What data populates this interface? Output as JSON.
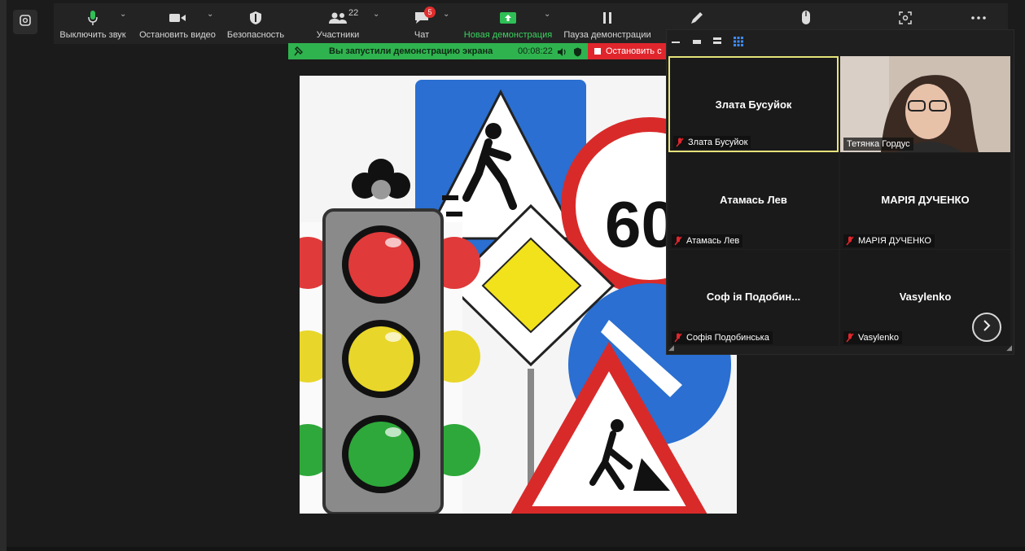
{
  "toolbar": {
    "items": [
      {
        "label": "Выключить звук",
        "icon": "microphone-icon"
      },
      {
        "label": "Остановить видео",
        "icon": "video-camera-icon"
      },
      {
        "label": "Безопасность",
        "icon": "shield-icon"
      },
      {
        "label": "Участники",
        "icon": "participants-icon",
        "count": "22"
      },
      {
        "label": "Чат",
        "icon": "chat-icon",
        "badge": "5"
      },
      {
        "label": "Новая демонстрация",
        "icon": "share-screen-icon"
      },
      {
        "label": "Пауза демонстрации",
        "icon": "pause-icon"
      },
      {
        "label": "",
        "icon": "annotate-pen-icon"
      },
      {
        "label": "",
        "icon": "remote-control-mouse-icon"
      },
      {
        "label": "",
        "icon": "record-icon"
      },
      {
        "label": "",
        "icon": "more-dots-icon"
      }
    ]
  },
  "sharing": {
    "message": "Вы запустили демонстрацию экрана",
    "timer": "00:08:22",
    "stop_label": "Остановить с"
  },
  "gallery": {
    "tiles": [
      {
        "display": "Злата Бусуйок",
        "tag": "Злата Бусуйок",
        "muted": true,
        "active": true,
        "video": false
      },
      {
        "display": "",
        "tag": "Тетянка Гордус",
        "muted": false,
        "active": false,
        "video": true
      },
      {
        "display": "Атамась Лев",
        "tag": "Атамась Лев",
        "muted": true,
        "active": false,
        "video": false
      },
      {
        "display": "МАРІЯ ДУЧЕНКО",
        "tag": "МАРІЯ ДУЧЕНКО",
        "muted": true,
        "active": false,
        "video": false
      },
      {
        "display": "Соф ія  Подобин...",
        "tag": "Софія Подобинська",
        "muted": true,
        "active": false,
        "video": false
      },
      {
        "display": "Vasylenko",
        "tag": "Vasylenko",
        "muted": true,
        "active": false,
        "video": false
      }
    ]
  },
  "shared_image": {
    "sign_number": "60"
  },
  "colors": {
    "toolbar_bg": "#232323",
    "share_green": "#2fb34f",
    "stop_red": "#e0262c",
    "active_border": "#e6e27a",
    "muted_red": "#e0262c"
  }
}
